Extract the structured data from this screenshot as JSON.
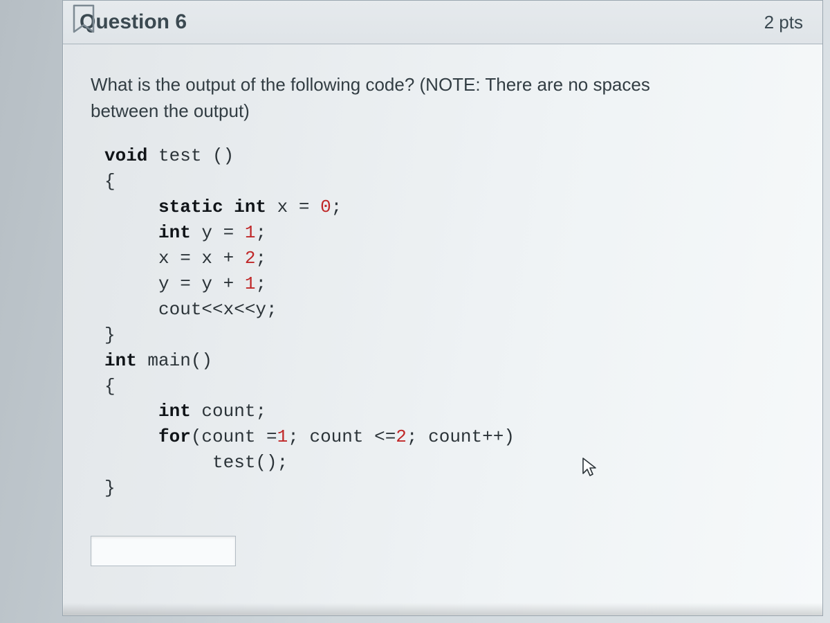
{
  "header": {
    "title": "Question 6",
    "points": "2 pts"
  },
  "prompt": "What is the output of the following code? (NOTE: There are no spaces between the output)",
  "code": {
    "l1a": "void",
    "l1b": " test ()",
    "l2": "{",
    "l3a": "     static int",
    "l3b": " x = ",
    "l3c": "0",
    "l3d": ";",
    "l4a": "     int",
    "l4b": " y = ",
    "l4c": "1",
    "l4d": ";",
    "l5a": "     x = x + ",
    "l5b": "2",
    "l5c": ";",
    "l6a": "     y = y + ",
    "l6b": "1",
    "l6c": ";",
    "l7": "     cout<<x<<y;",
    "l8": "}",
    "l9a": "int",
    "l9b": " main()",
    "l10": "{",
    "l11a": "     int",
    "l11b": " count;",
    "l12a": "     for",
    "l12b": "(count =",
    "l12c": "1",
    "l12d": "; count <=",
    "l12e": "2",
    "l12f": "; count++)",
    "l13": "          test();",
    "l14": "}"
  }
}
